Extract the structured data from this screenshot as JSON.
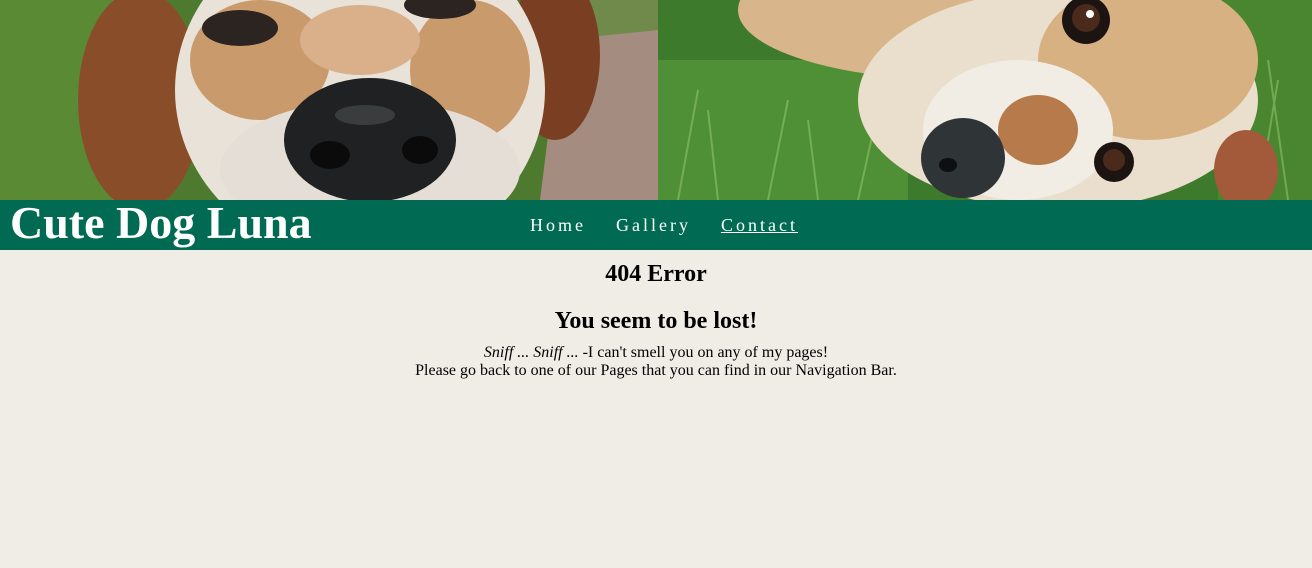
{
  "header": {
    "site_title": "Cute Dog Luna",
    "nav": [
      {
        "label": "Home",
        "active": false
      },
      {
        "label": "Gallery",
        "active": false
      },
      {
        "label": "Contact",
        "active": true
      }
    ],
    "colors": {
      "navbar_bg": "#006a52",
      "page_bg": "#f0ede7"
    }
  },
  "hero": {
    "left_photo": "dog-nose-closeup-photo",
    "right_photo": "dog-lying-in-grass-photo"
  },
  "main": {
    "error_code": "404 Error",
    "heading": "You seem to be lost!",
    "sniff_text": "Sniff ... Sniff ...",
    "line1_rest": " -I can't smell you on any of my pages!",
    "line2": "Please go back to one of our Pages that you can find in our Navigation Bar."
  }
}
